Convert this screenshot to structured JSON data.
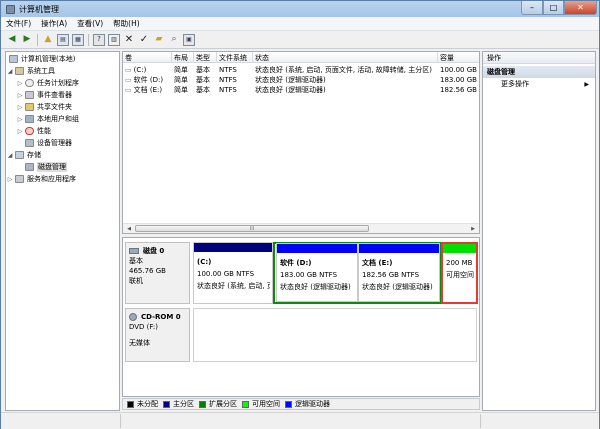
{
  "window": {
    "title": "计算机管理",
    "min": "–",
    "max": "□",
    "close": "✕"
  },
  "menu": [
    {
      "label": "文件(F)"
    },
    {
      "label": "操作(A)"
    },
    {
      "label": "查看(V)"
    },
    {
      "label": "帮助(H)"
    }
  ],
  "toolbar": {
    "icons": [
      "back-arrow-icon",
      "forward-arrow-icon",
      "up-folder-icon",
      "show-tree-icon",
      "properties-icon",
      "help-icon",
      "delete-icon",
      "check-icon",
      "open-icon",
      "search-icon",
      "format-icon"
    ]
  },
  "tree": {
    "root": "计算机管理(本地)",
    "system_tools": "系统工具",
    "task_scheduler": "任务计划程序",
    "event_viewer": "事件查看器",
    "shared_folders": "共享文件夹",
    "local_users": "本地用户和组",
    "performance": "性能",
    "device_manager": "设备管理器",
    "storage": "存储",
    "disk_management": "磁盘管理",
    "services": "服务和应用程序"
  },
  "volumes": {
    "headers": [
      "卷",
      "布局",
      "类型",
      "文件系统",
      "状态",
      "容量"
    ],
    "rows": [
      [
        "(C:)",
        "简单",
        "基本",
        "NTFS",
        "状态良好 (系统, 启动, 页面文件, 活动, 故障转储, 主分区)",
        "100.00 GB"
      ],
      [
        "软件 (D:)",
        "简单",
        "基本",
        "NTFS",
        "状态良好 (逻辑驱动器)",
        "183.00 GB"
      ],
      [
        "文档 (E:)",
        "简单",
        "基本",
        "NTFS",
        "状态良好 (逻辑驱动器)",
        "182.56 GB"
      ]
    ],
    "scroll_grip": "III"
  },
  "disk0": {
    "title": "磁盘 0",
    "type": "基本",
    "size": "465.76 GB",
    "status": "联机",
    "partitions": [
      {
        "name": "(C:)",
        "size": "100.00 GB NTFS",
        "status": "状态良好 (系统, 启动, 页面文件, 活动, 故障转储, 主分区)",
        "color": "#00007f"
      },
      {
        "name": "软件 (D:)",
        "size": "183.00 GB NTFS",
        "status": "状态良好 (逻辑驱动器)",
        "color": "#0000ff"
      },
      {
        "name": "文档 (E:)",
        "size": "182.56 GB NTFS",
        "status": "状态良好 (逻辑驱动器)",
        "color": "#0000ff"
      },
      {
        "name": "",
        "size": "200 MB",
        "status": "可用空间",
        "color": "#00e000"
      }
    ]
  },
  "cdrom0": {
    "title": "CD-ROM 0",
    "drive": "DVD (F:)",
    "status": "无媒体"
  },
  "legend": [
    {
      "label": "未分配",
      "color": "#000000"
    },
    {
      "label": "主分区",
      "color": "#00007f"
    },
    {
      "label": "扩展分区",
      "color": "#008000"
    },
    {
      "label": "可用空间",
      "color": "#00ff00"
    },
    {
      "label": "逻辑驱动器",
      "color": "#0000ff"
    }
  ],
  "actions": {
    "header": "操作",
    "section": "磁盘管理",
    "more": "更多操作"
  }
}
